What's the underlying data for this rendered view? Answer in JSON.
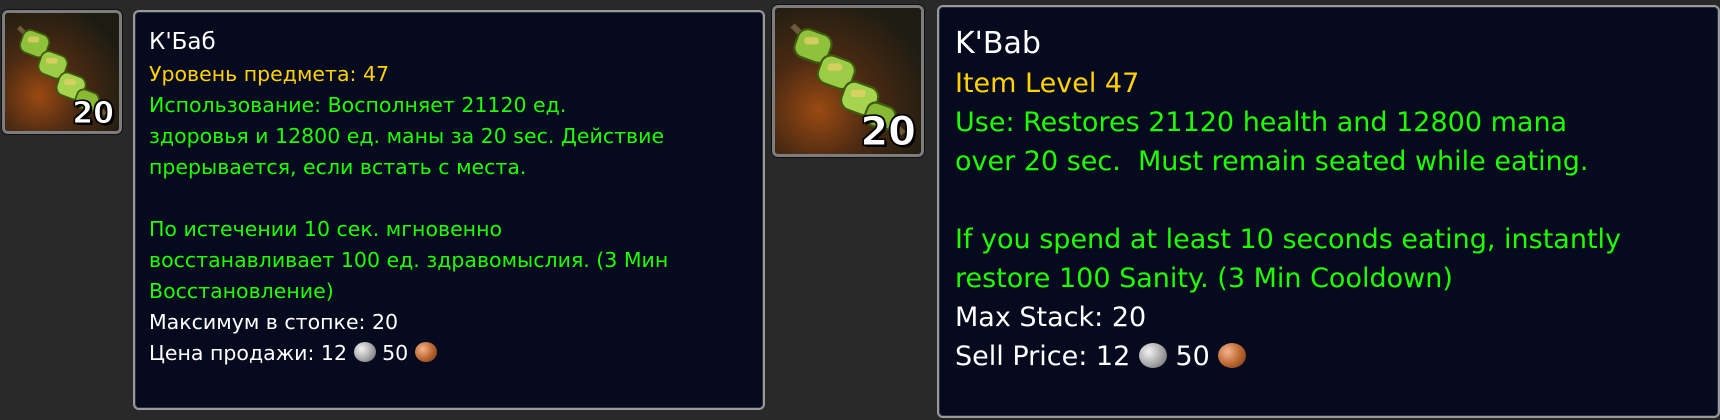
{
  "ru": {
    "name": "К'Баб",
    "item_level": "Уровень предмета: 47",
    "use_line1": "Использование: Восполняет 21120 ед.",
    "use_line2": "здоровья и 12800 ед. маны за 20 sec. Действие",
    "use_line3": "прерывается, если встать с места.",
    "bonus_line1": "По истечении 10 сек. мгновенно",
    "bonus_line2": "восстанавливает 100 ед. здравомыслия. (3 Мин",
    "bonus_line3": "Восстановление)",
    "max_stack": "Максимум в стопке: 20",
    "sell_label": "Цена продажи: ",
    "sell_silver": "12",
    "sell_copper": "50",
    "stack_count": "20"
  },
  "en": {
    "name": "K'Bab",
    "item_level": "Item Level 47",
    "use_line1": "Use: Restores 21120 health and 12800 mana",
    "use_line2": "over 20 sec.  Must remain seated while eating.",
    "bonus_line1": "If you spend at least 10 seconds eating, instantly",
    "bonus_line2": "restore 100 Sanity. (3 Min Cooldown)",
    "max_stack": "Max Stack: 20",
    "sell_label": "Sell Price: ",
    "sell_silver": "12",
    "sell_copper": "50",
    "stack_count": "20"
  },
  "colors": {
    "tooltip_bg": "#060a1f",
    "item_name": "#ffffff",
    "item_level": "#ffd200",
    "use_text": "#1eff00"
  },
  "icons": {
    "item": "kebab-skewer-icon",
    "silver": "silver-coin-icon",
    "copper": "copper-coin-icon"
  }
}
